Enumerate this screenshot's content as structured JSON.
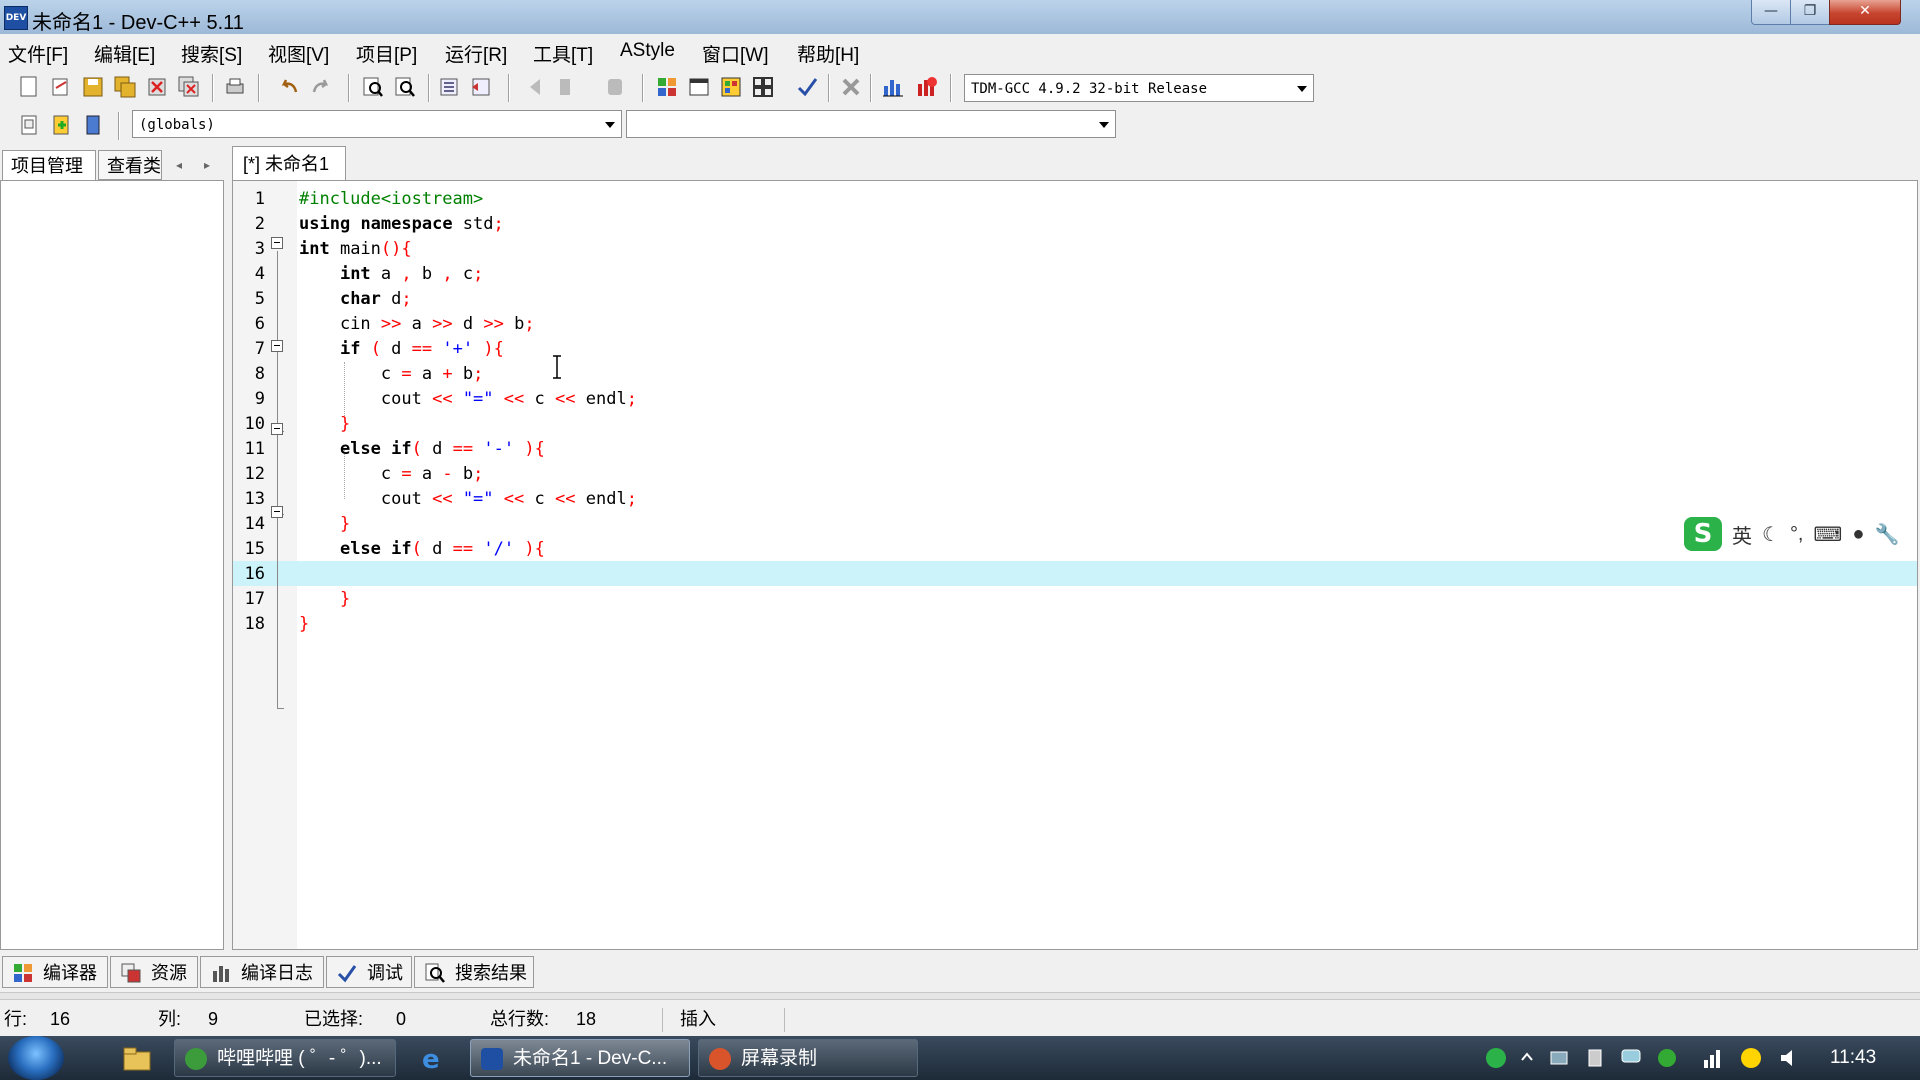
{
  "window": {
    "title": "未命名1 - Dev-C++ 5.11",
    "app_icon_label": "DEV"
  },
  "menu": [
    "文件[F]",
    "编辑[E]",
    "搜索[S]",
    "视图[V]",
    "项目[P]",
    "运行[R]",
    "工具[T]",
    "AStyle",
    "窗口[W]",
    "帮助[H]"
  ],
  "toolbar": {
    "compiler_select": "TDM-GCC 4.9.2 32-bit Release"
  },
  "toolbar2": {
    "scope_select": "(globals)",
    "member_select": ""
  },
  "left_panel": {
    "tabs": [
      "项目管理",
      "查看类"
    ]
  },
  "editor": {
    "tab_label": "[*] 未命名1",
    "current_line": 16,
    "lines": [
      {
        "n": "1"
      },
      {
        "n": "2"
      },
      {
        "n": "3"
      },
      {
        "n": "4"
      },
      {
        "n": "5"
      },
      {
        "n": "6"
      },
      {
        "n": "7"
      },
      {
        "n": "8"
      },
      {
        "n": "9"
      },
      {
        "n": "10"
      },
      {
        "n": "11"
      },
      {
        "n": "12"
      },
      {
        "n": "13"
      },
      {
        "n": "14"
      },
      {
        "n": "15"
      },
      {
        "n": "16"
      },
      {
        "n": "17"
      },
      {
        "n": "18"
      }
    ],
    "code": [
      "#include<iostream>",
      "using namespace std;",
      "int main(){",
      "    int a , b , c;",
      "    char d;",
      "    cin >> a >> d >> b;",
      "    if ( d == '+' ){",
      "        c = a + b;",
      "        cout << \"=\" << c << endl;",
      "    }",
      "    else if( d == '-' ){",
      "        c = a - b;",
      "        cout << \"=\" << c << endl;",
      "    }",
      "    else if( d == '/' ){",
      "",
      "    }",
      "}"
    ]
  },
  "ime_toolbar": {
    "logo": "S",
    "mode": "英",
    "icons": [
      "moon-icon",
      "comma-icon",
      "keyboard-icon",
      "user-icon",
      "wrench-icon"
    ]
  },
  "bottom_tabs": [
    "编译器",
    "资源",
    "编译日志",
    "调试",
    "搜索结果"
  ],
  "status": {
    "row_label": "行:",
    "row": "16",
    "col_label": "列:",
    "col": "9",
    "sel_label": "已选择:",
    "sel": "0",
    "total_label": "总行数:",
    "total": "18",
    "mode": "插入"
  },
  "taskbar": {
    "buttons": [
      "哔哩哔哩 ( ゜- ゜)...",
      "未命名1 - Dev-C...",
      "屏幕录制"
    ],
    "clock": "11:43"
  },
  "colors": {
    "keyword": "#000080",
    "preprocessor": "#008000",
    "symbol": "#ff0000",
    "string": "#0000ff",
    "current_line": "#cdf3fa"
  }
}
